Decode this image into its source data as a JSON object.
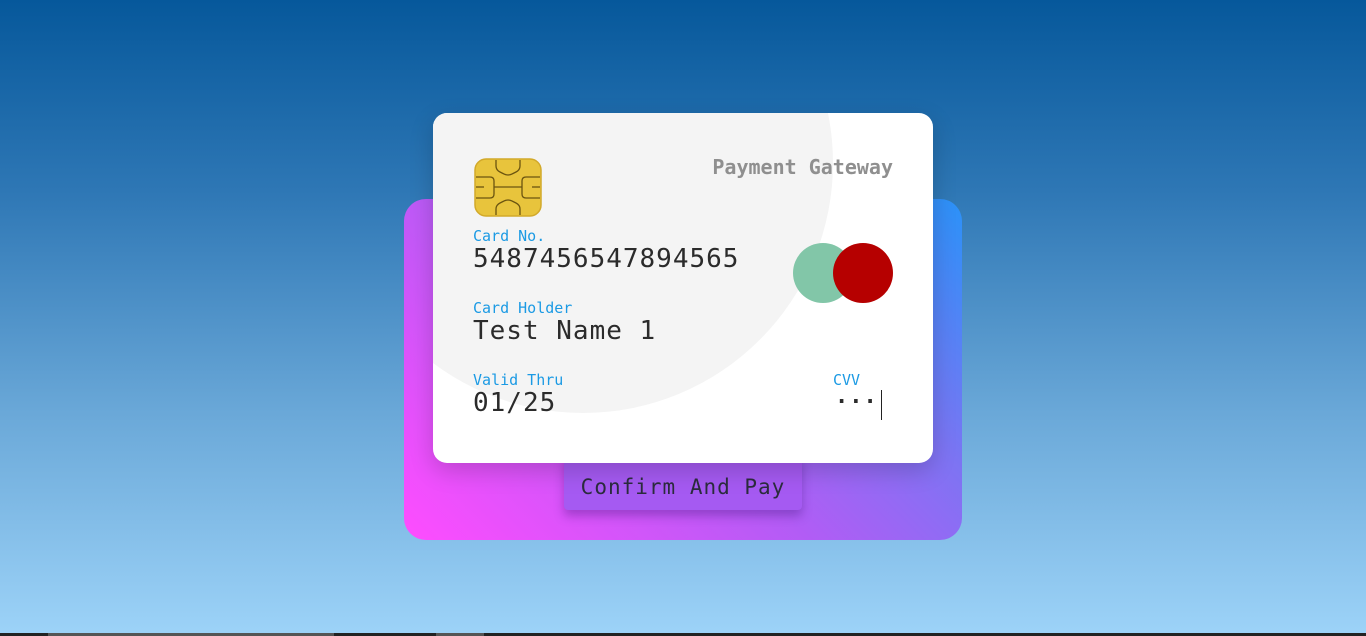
{
  "card": {
    "brand": "Payment Gateway",
    "card_number_label": "Card No.",
    "card_number": "5487456547894565",
    "holder_label": "Card Holder",
    "holder_name": "Test Name 1",
    "valid_label": "Valid Thru",
    "valid_value": "01/25",
    "cvv_label": "CVV",
    "cvv_value": "···",
    "logo_colors": [
      "#82c6a8",
      "#b60000"
    ]
  },
  "actions": {
    "pay_label": "Confirm And Pay"
  },
  "colors": {
    "label_accent": "#1b9ae4",
    "panel_gradient": [
      "#ff4cff",
      "#b25cf5",
      "#7d74f3",
      "#2a92f8"
    ],
    "button_bg": "#a55af2",
    "chip": "#e8c43c"
  },
  "icons": {
    "chip": "sim-chip-icon",
    "logo": "card-network-logo"
  }
}
